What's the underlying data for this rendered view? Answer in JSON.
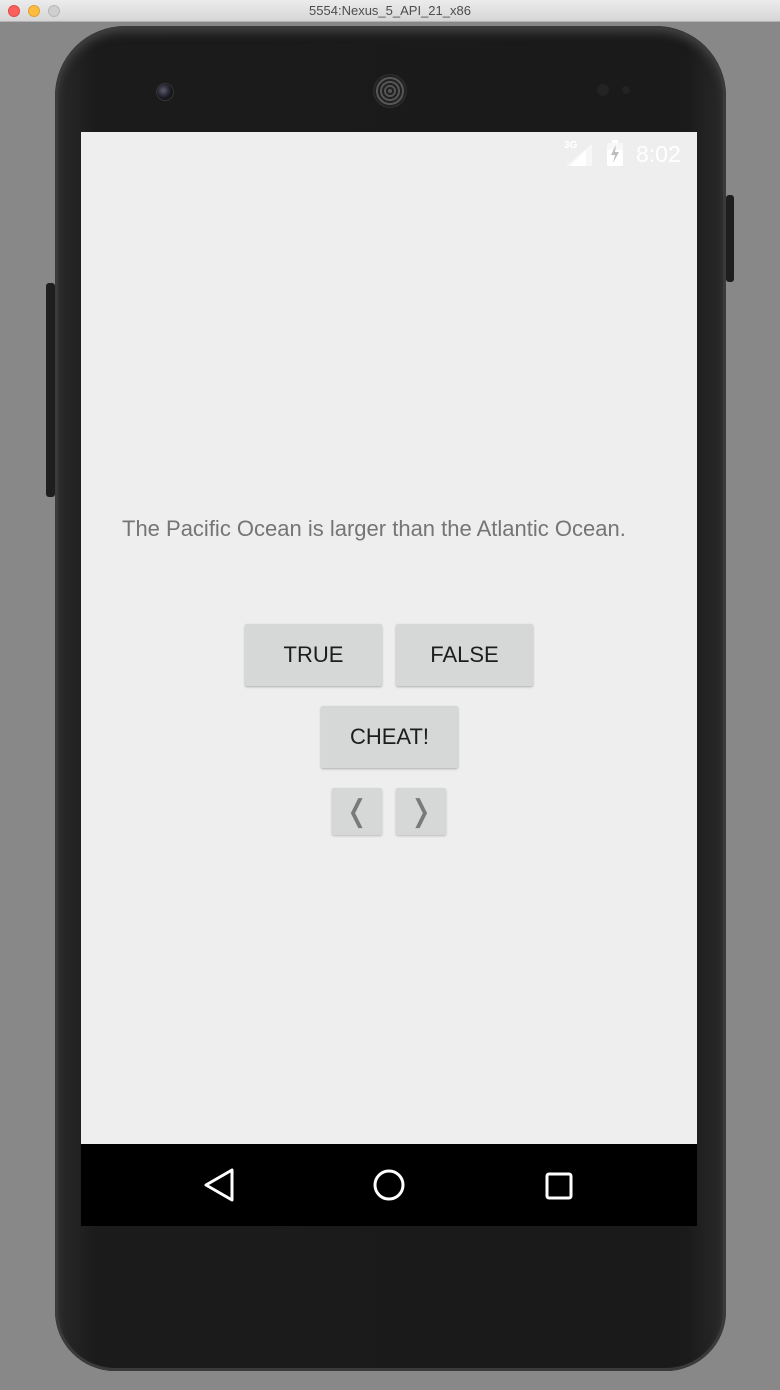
{
  "window": {
    "title": "5554:Nexus_5_API_21_x86"
  },
  "status_bar": {
    "network_type": "3G",
    "time": "8:02",
    "icons": [
      "signal-icon",
      "battery-icon"
    ]
  },
  "quiz": {
    "question": "The Pacific Ocean is larger than the Atlantic Ocean.",
    "true_label": "TRUE",
    "false_label": "FALSE",
    "cheat_label": "CHEAT!",
    "prev_glyph": "❬",
    "next_glyph": "❭"
  },
  "nav_bar": {
    "icons": [
      "back-icon",
      "home-icon",
      "recents-icon"
    ]
  },
  "colors": {
    "screen_bg": "#eeeeee",
    "button_bg": "#d6d7d7",
    "question_text": "#757575"
  }
}
